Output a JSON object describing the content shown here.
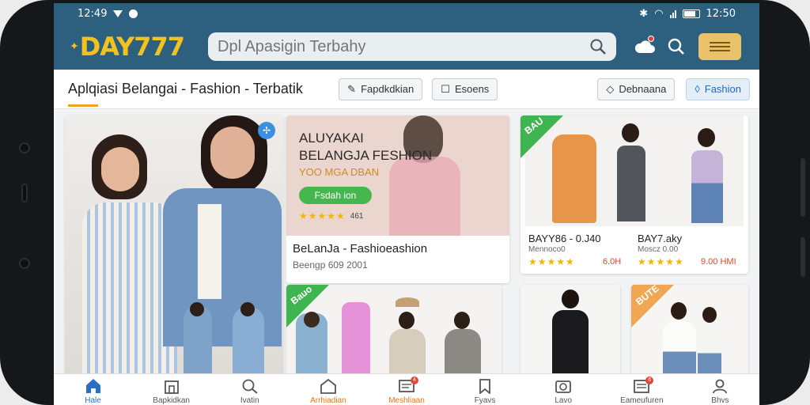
{
  "status": {
    "time": "12:49",
    "clock": "12:50"
  },
  "header": {
    "logo": "DAY777",
    "search_placeholder": "Dpl Apasigin Terbahy"
  },
  "title_row": {
    "title": "Aplqiasi Belangai - Fashion - Terbatik",
    "chips": [
      {
        "label": "Fapdkdkian",
        "icon": "tag-icon"
      },
      {
        "label": "Esoens",
        "icon": "thumb-icon"
      },
      {
        "label": "Debnaana",
        "icon": "tag-icon"
      },
      {
        "label": "Fashion",
        "icon": "diamond-icon"
      }
    ]
  },
  "promo": {
    "heading_line1": "ALUYAKAI",
    "heading_line2": "BELANGJA FESHION",
    "subheading": "YOO MGA DBAN",
    "button": "Fsdah ion",
    "rating": "461",
    "name": "BeLanJa - Fashioeashion",
    "meta": "Beengp 609 2001"
  },
  "product_card": {
    "ribbon": "BAU",
    "name_left": "BAYY86 - 0.J40",
    "name_right": "BAY7.aky",
    "sub_left": "Mennoco0",
    "sub_right": "Moscz 0.00",
    "price_left": "6.0H",
    "price_right": "9.00 HMI"
  },
  "grid_ribbons": {
    "card1": "Bauo",
    "card2": "BUTE"
  },
  "colors": {
    "brand": "#2d5f7e",
    "logo": "#f4c21f",
    "ribbon_green": "#3fb450",
    "ribbon_orange": "#f0a652",
    "accent": "#f0a31b"
  },
  "bottom_nav": [
    {
      "label": "Hale",
      "icon": "home-icon",
      "active": true
    },
    {
      "label": "Bapkidkan",
      "icon": "shop-icon"
    },
    {
      "label": "Ivatin",
      "icon": "search-icon"
    },
    {
      "label": "Arrhiadian",
      "icon": "house-icon",
      "badge": ""
    },
    {
      "label": "Meshliaan",
      "icon": "message-icon",
      "badge": "4"
    },
    {
      "label": "Fyavs",
      "icon": "bookmark-icon"
    },
    {
      "label": "Lavo",
      "icon": "camera-icon"
    },
    {
      "label": "Eameufuren",
      "icon": "list-icon",
      "badge": "6"
    },
    {
      "label": "Bhvs",
      "icon": "user-icon"
    }
  ]
}
